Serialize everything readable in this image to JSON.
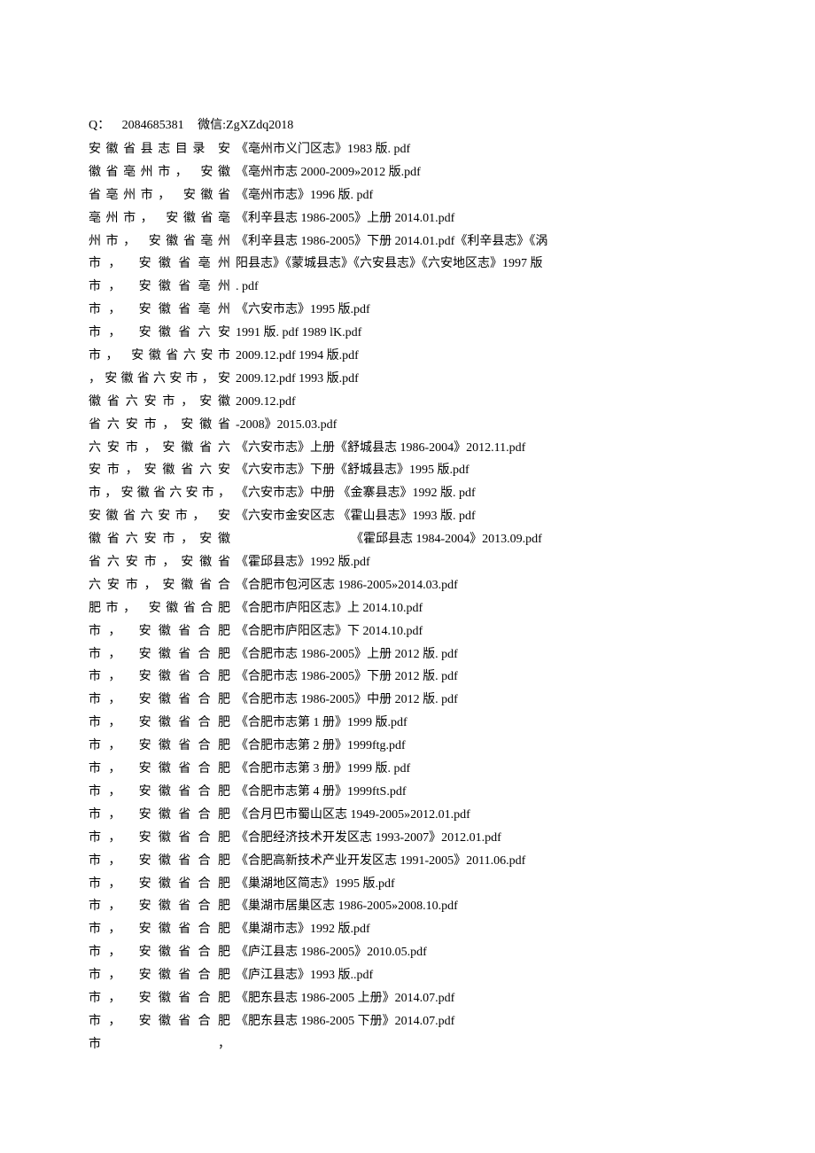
{
  "header": {
    "q_label": "Q：",
    "q_value": "2084685381",
    "wx_label": "微信:",
    "wx_value": "ZgXZdq2018"
  },
  "left_column": [
    "安徽省县志目录  安",
    "徽省亳州市，   安徽",
    "省亳州市，   安徽省",
    "亳州市，   安徽省亳",
    "州市，   安徽省亳州",
    "市，    安徽省亳州",
    "市，    安徽省亳州",
    "市，    安徽省亳州",
    "市，    安徽省六安",
    "市，   安徽省六安市",
    "，安徽省六安市，安",
    "徽省六安市，安徽",
    "省六安市，安徽省",
    "六安市，安徽省六",
    "安市，安徽省六安",
    "市，安徽省六安市，",
    "安徽省六安市，   安",
    "徽省六安市，安徽",
    "省六安市，安徽省",
    "六安市，安徽省合",
    "肥市，   安徽省合肥",
    "市，    安徽省合肥",
    "市，    安徽省合肥",
    "市，    安徽省合肥",
    "市，    安徽省合肥",
    "市，    安徽省合肥",
    "市，    安徽省合肥",
    "市，    安徽省合肥",
    "市，    安徽省合肥",
    "市，    安徽省合肥",
    "市，    安徽省合肥",
    "市，    安徽省合肥",
    "市，    安徽省合肥",
    "市，    安徽省合肥",
    "市，    安徽省合肥",
    "市，    安徽省合肥",
    "市，    安徽省合肥",
    "市，    安徽省合肥",
    "市，    安徽省合肥",
    "市，"
  ],
  "right_column_block1": [
    "《亳州市义门区志》1983 版. pdf",
    "《亳州市志 2000-2009»2012 版.pdf",
    "《亳州市志》1996 版. pdf",
    "《利辛县志 1986-2005》上册 2014.01.pdf",
    "《利辛县志 1986-2005》下册 2014.01.pdf《利辛县志》《涡",
    "阳县志》《蒙城县志》《六安县志》《六安地区志》1997 版",
    ". pdf",
    "《六安市志》1995 版.pdf",
    "1991 版. pdf  1989 lK.pdf",
    "2009.12.pdf  1994 版.pdf",
    "2009.12.pdf  1993 版.pdf",
    "2009.12.pdf",
    "-2008》2015.03.pdf",
    "《六安市志》上册《舒城县志 1986-2004》2012.11.pdf",
    "《六安市志》下册《舒城县志》1995 版.pdf",
    "《六安市志》中册 《金寨县志》1992 版. pdf",
    "《六安市金安区志    《霍山县志》1993 版. pdf"
  ],
  "right_column_indent": [
    "《霍邱县志 1984-2004》2013.09.pdf"
  ],
  "right_column_block2": [
    "《霍邱县志》1992 版.pdf",
    "《合肥市包河区志 1986-2005»2014.03.pdf",
    "《合肥市庐阳区志》上 2014.10.pdf",
    "《合肥市庐阳区志》下 2014.10.pdf",
    "《合肥市志 1986-2005》上册 2012 版. pdf",
    "《合肥市志 1986-2005》下册 2012 版. pdf",
    "《合肥市志 1986-2005》中册 2012 版. pdf",
    "《合肥市志第 1 册》1999 版.pdf",
    "《合肥市志第 2 册》1999ftg.pdf",
    "《合肥市志第 3 册》1999 版. pdf",
    "《合肥市志第 4 册》1999ftS.pdf",
    "《合月巴市蜀山区志 1949-2005»2012.01.pdf",
    "《合肥经济技术开发区志 1993-2007》2012.01.pdf",
    "《合肥高新技术产业开发区志 1991-2005》2011.06.pdf",
    "《巢湖地区简志》1995 版.pdf",
    "《巢湖市居巢区志 1986-2005»2008.10.pdf",
    "《巢湖市志》1992 版.pdf",
    "《庐江县志 1986-2005》2010.05.pdf",
    "《庐江县志》1993 版..pdf",
    "《肥东县志 1986-2005 上册》2014.07.pdf",
    "《肥东县志 1986-2005 下册》2014.07.pdf"
  ]
}
